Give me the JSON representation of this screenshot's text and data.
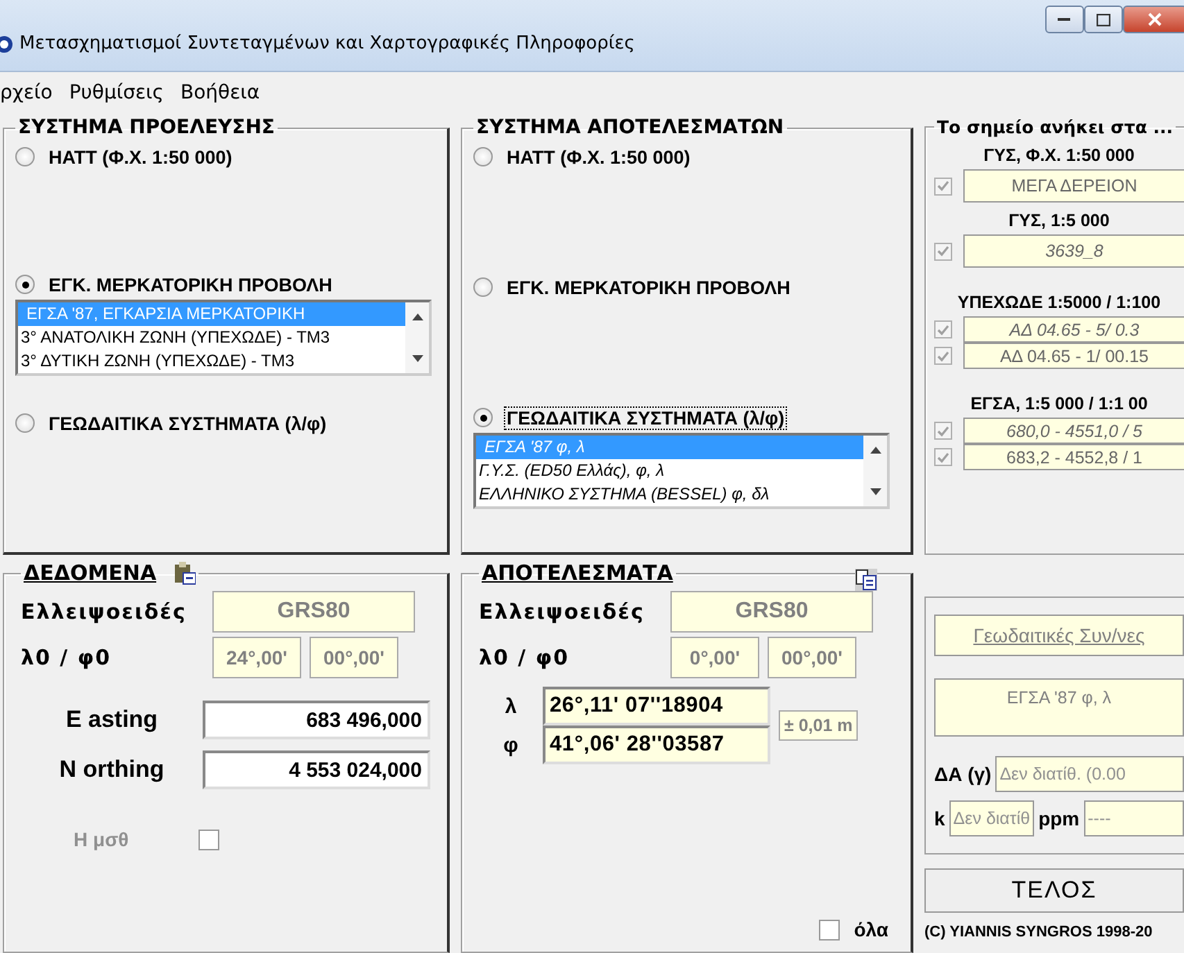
{
  "window": {
    "title": "Μετασχηματισμοί Συντεταγμένων και Χαρτογραφικές Πληροφορίες"
  },
  "menu": [
    "ρχείο",
    "Ρυθμίσεις",
    "Βοήθεια"
  ],
  "systems": [
    {
      "title": "ΣΥΣΤΗΜΑ ΠΡΟΕΛΕΥΣΗΣ",
      "options": [
        {
          "label": "ΗΑΤΤ (Φ.Χ. 1:50 000)",
          "selected": false,
          "focused": false
        },
        {
          "label": "ΕΓΚ. ΜΕΡΚΑΤΟΡΙΚΗ ΠΡΟΒΟΛΗ",
          "selected": true,
          "focused": false,
          "list": {
            "italic": false,
            "items": [
              {
                "text": "ΕΓΣΑ '87, ΕΓΚΑΡΣΙΑ ΜΕΡΚΑΤΟΡΙΚΗ",
                "selected": true
              },
              {
                "text": "3° ΑΝΑΤΟΛΙΚΗ ΖΩΝΗ (ΥΠΕΧΩΔΕ) - ΤΜ3",
                "selected": false
              },
              {
                "text": "3° ΔΥΤΙΚΗ ΖΩΝΗ (ΥΠΕΧΩΔΕ) - ΤΜ3",
                "selected": false
              }
            ]
          }
        },
        {
          "label": "ΓΕΩΔΑΙΤΙΚΑ ΣΥΣΤΗΜΑΤΑ (λ/φ)",
          "selected": false,
          "focused": false
        }
      ]
    },
    {
      "title": "ΣΥΣΤΗΜΑ ΑΠΟΤΕΛΕΣΜΑΤΩΝ",
      "options": [
        {
          "label": "ΗΑΤΤ (Φ.Χ. 1:50 000)",
          "selected": false,
          "focused": false
        },
        {
          "label": "ΕΓΚ. ΜΕΡΚΑΤΟΡΙΚΗ ΠΡΟΒΟΛΗ",
          "selected": false,
          "focused": false
        },
        {
          "label": "ΓΕΩΔΑΙΤΙΚΑ ΣΥΣΤΗΜΑΤΑ (λ/φ)",
          "selected": true,
          "focused": true,
          "list": {
            "italic": true,
            "items": [
              {
                "text": "ΕΓΣΑ '87 φ, λ",
                "selected": true
              },
              {
                "text": "Γ.Υ.Σ. (ED50 Ελλάς), φ, λ",
                "selected": false
              },
              {
                "text": "ΕΛΛΗΝΙΚΟ ΣΥΣΤΗΜΑ (BESSEL) φ, δλ",
                "selected": false
              }
            ]
          }
        }
      ]
    }
  ],
  "membership": {
    "title": "Το σημείο ανήκει στα ...",
    "groups": [
      {
        "heading": "ΓΥΣ, Φ.Χ. 1:50 000",
        "entries": [
          {
            "value": "ΜΕΓΑ ΔΕΡΕΙΟΝ",
            "checked": true,
            "italic": false
          }
        ]
      },
      {
        "heading": "ΓΥΣ,  1:5 000",
        "entries": [
          {
            "value": "3639_8",
            "checked": true,
            "italic": true
          }
        ]
      },
      {
        "heading": "ΥΠΕΧΩΔΕ 1:5000 / 1:100",
        "entries": [
          {
            "value": "ΑΔ 04.65 - 5/ 0.3",
            "checked": true,
            "italic": true
          },
          {
            "value": "ΑΔ 04.65 - 1/ 00.15",
            "checked": true,
            "italic": false
          }
        ]
      },
      {
        "heading": "ΕΓΣΑ, 1:5 000 / 1:1 00",
        "entries": [
          {
            "value": "680,0 - 4551,0 / 5",
            "checked": true,
            "italic": true
          },
          {
            "value": "683,2 - 4552,8 / 1",
            "checked": true,
            "italic": false
          }
        ]
      }
    ]
  },
  "data": {
    "title": "ΔΕΔΟΜΕΝΑ",
    "ellipsoid_label": "Ελλειψοειδές",
    "ellipsoid": "GRS80",
    "origin_label": "λ0 / φ0",
    "lambda0": "24°,00'",
    "phi0": "00°,00'",
    "fields": [
      {
        "label": "E asting",
        "value": "683 496,000"
      },
      {
        "label": "N orthing",
        "value": "4 553 024,000"
      }
    ],
    "height": {
      "label": "Η μσθ",
      "checked": false
    }
  },
  "results": {
    "title": "ΑΠΟΤΕΛΕΣΜΑΤΑ",
    "ellipsoid_label": "Ελλειψοειδές",
    "ellipsoid": "GRS80",
    "origin_label": "λ0 / φ0",
    "lambda0": "0°,00'",
    "phi0": "00°,00'",
    "coords": [
      {
        "label": "λ",
        "value": "26°,11' 07''18904"
      },
      {
        "label": "φ",
        "value": "41°,06' 28''03587"
      }
    ],
    "accuracy": "± 0,01 m",
    "all": {
      "label": "όλα",
      "checked": false
    }
  },
  "info": {
    "link": "Γεωδαιτικές Συν/νες",
    "system": "ΕΓΣΑ '87 φ, λ",
    "da_label": "ΔΑ (γ)",
    "da": "Δεν διατίθ. (0.00",
    "k_label": "k",
    "k": "Δεν διατίθ",
    "ppm_label": "ppm",
    "ppm": "----"
  },
  "end_button": "ΤΕΛΟΣ",
  "copyright": "(C) YIANNIS SYNGROS 1998-20"
}
